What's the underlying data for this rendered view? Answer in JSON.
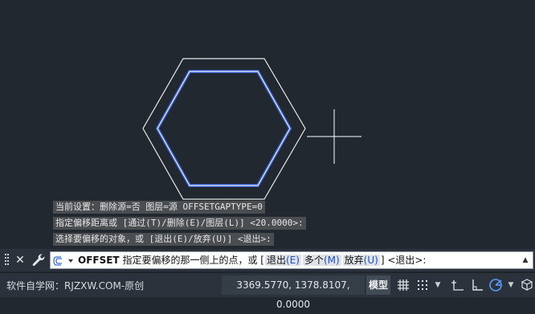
{
  "history": {
    "line1": "当前设置：删除源=否  图层=源  OFFSETGAPTYPE=0",
    "line2": "指定偏移距离或 [通过(T)/删除(E)/图层(L)] <20.0000>:",
    "line3": "选择要偏移的对象，或 [退出(E)/放弃(U)] <退出>:"
  },
  "command": {
    "keyword": "OFFSET",
    "prompt": "指定要偏移的那一侧上的点，或 [",
    "options": [
      {
        "label": "退出",
        "key": "(E)"
      },
      {
        "label": "多个",
        "key": "(M)"
      },
      {
        "label": "放弃",
        "key": "(U)"
      }
    ],
    "suffix": "] <退出>:"
  },
  "status": {
    "watermark": "软件自学网：RJZXW.COM-原创",
    "coordinates": "3369.5770, 1378.8107, 0.0000",
    "model": "模型"
  },
  "icons": {
    "close": "close-icon",
    "wrench": "wrench-icon",
    "command": "command-line-icon",
    "grid": "grid-icon",
    "snap": "snap-icon",
    "ortho": "ortho-icon",
    "polar": "polar-tracking-icon"
  },
  "colors": {
    "canvas": "#212830",
    "selected": "#5b86ff",
    "geometry": "#ffffff",
    "option_key": "#1a4fc4"
  }
}
